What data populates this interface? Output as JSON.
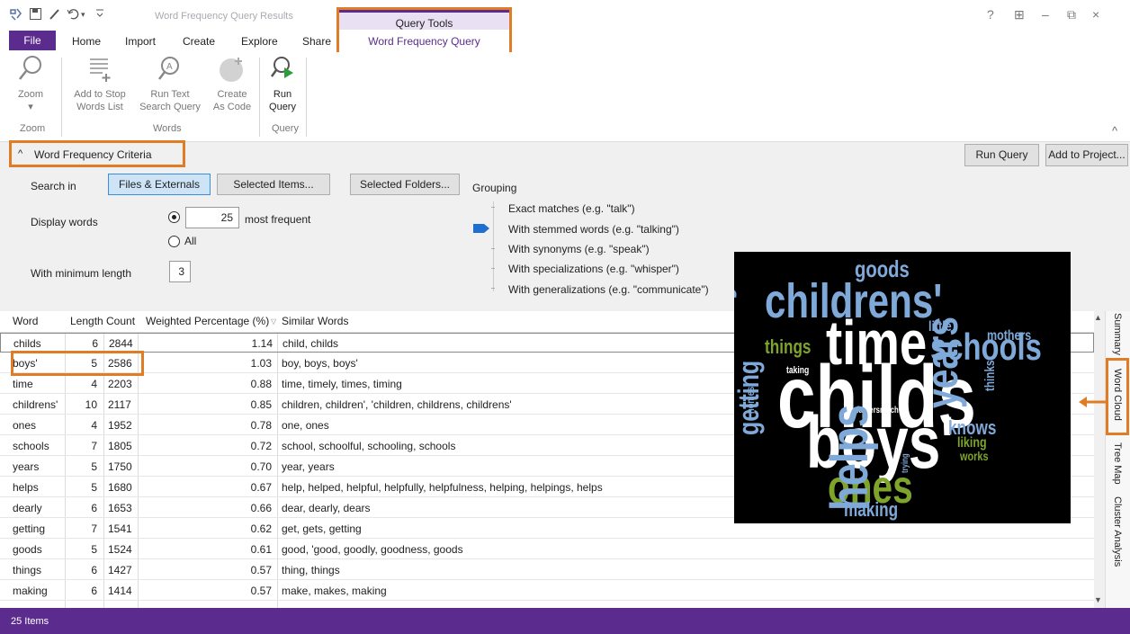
{
  "window": {
    "title": "Word Frequency Query Results",
    "caption_buttons": [
      "?",
      "⊞",
      "–",
      "⧉",
      "×"
    ]
  },
  "menu": {
    "file": "File",
    "items": [
      "Home",
      "Import",
      "Create",
      "Explore",
      "Share"
    ],
    "context_group": "Query Tools",
    "context_tab": "Word Frequency Query"
  },
  "ribbon": {
    "zoom": {
      "label": "Zoom",
      "group": "Zoom"
    },
    "add_stop": {
      "line1": "Add to Stop",
      "line2": "Words List"
    },
    "run_text_search": {
      "line1": "Run Text",
      "line2": "Search Query"
    },
    "create_as_code": {
      "line1": "Create",
      "line2": "As Code"
    },
    "words_group": "Words",
    "run_query": {
      "line1": "Run",
      "line2": "Query"
    },
    "query_group": "Query"
  },
  "criteria": {
    "header": "Word Frequency Criteria",
    "run_query": "Run Query",
    "add_to_project": "Add to Project...",
    "search_in": "Search in",
    "btn_files": "Files & Externals",
    "btn_items": "Selected Items...",
    "btn_folders": "Selected Folders...",
    "display_words": "Display words",
    "count_value": "25",
    "most_frequent": "most frequent",
    "all": "All",
    "min_length_label": "With minimum length",
    "min_length_value": "3",
    "grouping_label": "Grouping",
    "grouping_options": [
      "Exact matches (e.g. \"talk\")",
      "With stemmed words (e.g. \"talking\")",
      "With synonyms (e.g. \"speak\")",
      "With specializations (e.g. \"whisper\")",
      "With generalizations (e.g. \"communicate\")"
    ],
    "grouping_selected_index": 1
  },
  "table": {
    "headers": [
      "Word",
      "Length",
      "Count",
      "Weighted Percentage (%)",
      "Similar Words"
    ],
    "rows": [
      {
        "word": "childs",
        "length": "6",
        "count": "2844",
        "pct": "1.14",
        "similar": "child, childs"
      },
      {
        "word": "boys'",
        "length": "5",
        "count": "2586",
        "pct": "1.03",
        "similar": "boy, boys, boys'"
      },
      {
        "word": "time",
        "length": "4",
        "count": "2203",
        "pct": "0.88",
        "similar": "time, timely, times, timing"
      },
      {
        "word": "childrens'",
        "length": "10",
        "count": "2117",
        "pct": "0.85",
        "similar": "children, children', 'children, childrens, childrens'"
      },
      {
        "word": "ones",
        "length": "4",
        "count": "1952",
        "pct": "0.78",
        "similar": "one, ones"
      },
      {
        "word": "schools",
        "length": "7",
        "count": "1805",
        "pct": "0.72",
        "similar": "school, schoolful, schooling, schools"
      },
      {
        "word": "years",
        "length": "5",
        "count": "1750",
        "pct": "0.70",
        "similar": "year, years"
      },
      {
        "word": "helps",
        "length": "5",
        "count": "1680",
        "pct": "0.67",
        "similar": "help, helped, helpful, helpfully, helpfulness, helping, helpings, helps"
      },
      {
        "word": "dearly",
        "length": "6",
        "count": "1653",
        "pct": "0.66",
        "similar": "dear, dearly, dears"
      },
      {
        "word": "getting",
        "length": "7",
        "count": "1541",
        "pct": "0.62",
        "similar": "get, gets, getting"
      },
      {
        "word": "goods",
        "length": "5",
        "count": "1524",
        "pct": "0.61",
        "similar": "good, 'good, goodly, goodness, goods"
      },
      {
        "word": "things",
        "length": "6",
        "count": "1427",
        "pct": "0.57",
        "similar": "thing, things"
      },
      {
        "word": "making",
        "length": "6",
        "count": "1414",
        "pct": "0.57",
        "similar": "make, makes, making"
      }
    ]
  },
  "side_tabs": [
    "Summary",
    "Word Cloud",
    "Tree Map",
    "Cluster Analysis"
  ],
  "status": {
    "items": "25 Items"
  },
  "cloud": {
    "words": [
      "goods",
      "childrens'",
      "little",
      "mothers",
      "things",
      "time",
      "schools",
      "taking",
      "dearly",
      "childs",
      "years",
      "thinks",
      "fathersmuch",
      "homes",
      "getting",
      "boys'",
      "knows",
      "liking",
      "works",
      "trying",
      "ones",
      "helps",
      "making"
    ]
  },
  "colors": {
    "accent": "#5b2c8e",
    "highlight": "#e07b26",
    "cloud_blue": "#7fa9d9",
    "cloud_green": "#7ea52a",
    "cloud_white": "#ffffff"
  }
}
